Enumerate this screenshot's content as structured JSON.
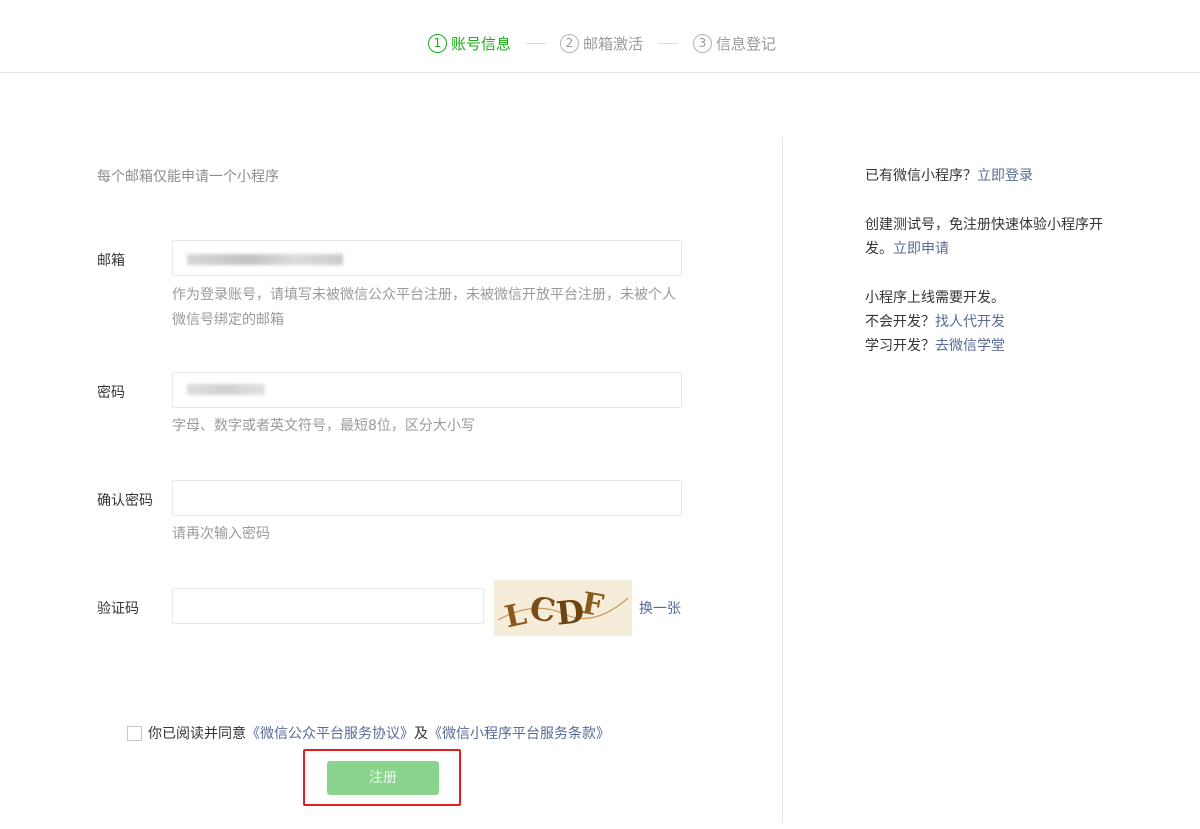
{
  "steps": [
    {
      "num": "1",
      "label": "账号信息"
    },
    {
      "num": "2",
      "label": "邮箱激活"
    },
    {
      "num": "3",
      "label": "信息登记"
    }
  ],
  "form": {
    "tip": "每个邮箱仅能申请一个小程序",
    "email_label": "邮箱",
    "email_hint": "作为登录账号，请填写未被微信公众平台注册，未被微信开放平台注册，未被个人微信号绑定的邮箱",
    "password_label": "密码",
    "password_hint": "字母、数字或者英文符号，最短8位，区分大小写",
    "confirm_label": "确认密码",
    "confirm_hint": "请再次输入密码",
    "captcha_label": "验证码",
    "captcha_text": "LCDF",
    "captcha_refresh": "换一张"
  },
  "agreement": {
    "prefix": "你已阅读并同意",
    "link1": "《微信公众平台服务协议》",
    "and": "及",
    "link2": "《微信小程序平台服务条款》"
  },
  "register_button": "注册",
  "sidebar": {
    "login_q": "已有微信小程序？",
    "login_link": "立即登录",
    "test_text": "创建测试号，免注册快速体验小程序开发。",
    "test_link": "立即申请",
    "dev_line1": "小程序上线需要开发。",
    "dev_q1": "不会开发？",
    "dev_link1": "找人代开发",
    "dev_q2": "学习开发？",
    "dev_link2": "去微信学堂"
  },
  "colors": {
    "accent_green": "#1aad19",
    "link_blue": "#576b95",
    "highlight_red": "#e02020"
  }
}
